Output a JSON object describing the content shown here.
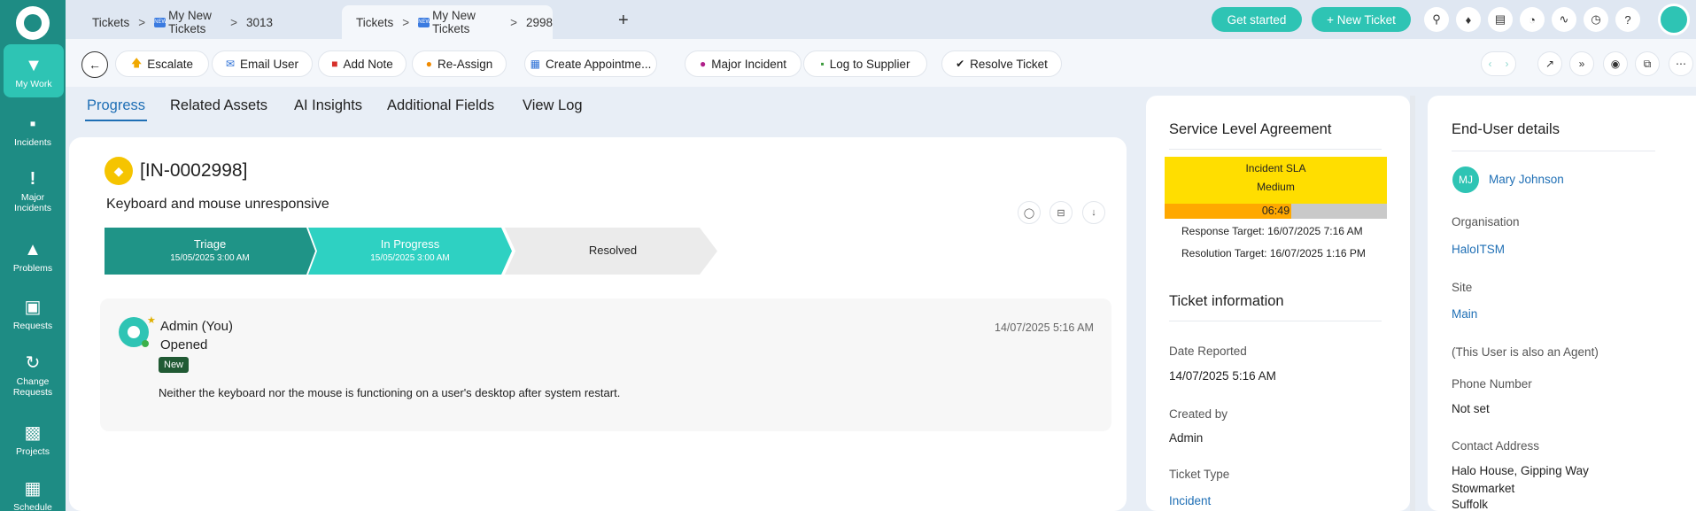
{
  "sidebar": {
    "items": [
      {
        "label": "My Work",
        "icon": "pin-icon"
      },
      {
        "label": "Incidents",
        "icon": "ticket-icon"
      },
      {
        "label": "Major Incidents",
        "icon": "exclamation-icon"
      },
      {
        "label": "Problems",
        "icon": "warning-icon"
      },
      {
        "label": "Requests",
        "icon": "cart-icon"
      },
      {
        "label": "Change Requests",
        "icon": "refresh-icon"
      },
      {
        "label": "Projects",
        "icon": "briefcase-icon"
      },
      {
        "label": "Schedule",
        "icon": "calendar-icon"
      }
    ]
  },
  "tabs": [
    {
      "root": "Tickets",
      "name": "My New Tickets",
      "id": "3013"
    },
    {
      "root": "Tickets",
      "name": "My New Tickets",
      "id": "2998"
    }
  ],
  "header": {
    "get_started": "Get started",
    "new_ticket": "+ New Ticket"
  },
  "actions": [
    {
      "label": "Escalate",
      "icon": "arrow-up-icon",
      "color": "#f0a800"
    },
    {
      "label": "Email User",
      "icon": "envelope-icon",
      "color": "#2b6fd6"
    },
    {
      "label": "Add Note",
      "icon": "note-icon",
      "color": "#d6302b"
    },
    {
      "label": "Re-Assign",
      "icon": "users-icon",
      "color": "#f08a00"
    },
    {
      "label": "Create Appointme...",
      "icon": "calendar-icon",
      "color": "#2b6fd6"
    },
    {
      "label": "Major Incident",
      "icon": "exclamation-circle-icon",
      "color": "#b0208a"
    },
    {
      "label": "Log to Supplier",
      "icon": "truck-icon",
      "color": "#3c9a3c"
    },
    {
      "label": "Resolve Ticket",
      "icon": "check-icon",
      "color": "#222222"
    }
  ],
  "subtabs": [
    "Progress",
    "Related Assets",
    "AI Insights",
    "Additional Fields",
    "View Log"
  ],
  "ticket": {
    "id": "[IN-0002998]",
    "title": "Keyboard and mouse unresponsive",
    "stages": [
      {
        "label": "Triage",
        "date": "15/05/2025 3:00 AM",
        "color": "#1f9487"
      },
      {
        "label": "In Progress",
        "date": "15/05/2025 3:00 AM",
        "color": "#2ed1c2"
      },
      {
        "label": "Resolved",
        "date": "",
        "color": "#ebebeb"
      }
    ]
  },
  "note": {
    "author": "Admin (You)",
    "action": "Opened",
    "time": "14/07/2025 5:16 AM",
    "badge": "New",
    "body": "Neither the keyboard nor the mouse is functioning on a user's desktop after system restart."
  },
  "sla": {
    "title": "Service Level Agreement",
    "name": "Incident SLA",
    "priority": "Medium",
    "remaining": "06:49",
    "elapsed_fraction": 0.57,
    "response_target": "Response Target: 16/07/2025 7:16 AM",
    "resolution_target": "Resolution Target: 16/07/2025 1:16 PM"
  },
  "ticket_info": {
    "title": "Ticket information",
    "date_reported_label": "Date Reported",
    "date_reported": "14/07/2025 5:16 AM",
    "created_by_label": "Created by",
    "created_by": "Admin",
    "ticket_type_label": "Ticket Type",
    "ticket_type": "Incident"
  },
  "end_user": {
    "title": "End-User details",
    "initials": "MJ",
    "name": "Mary Johnson",
    "organisation_label": "Organisation",
    "organisation": "HaloITSM",
    "site_label": "Site",
    "site": "Main",
    "agent_note": "(This User is also an Agent)",
    "phone_label": "Phone Number",
    "phone": "Not set",
    "address_label": "Contact Address",
    "address_1": "Halo House, Gipping Way",
    "address_2": "Stowmarket",
    "address_3": "Suffolk"
  }
}
